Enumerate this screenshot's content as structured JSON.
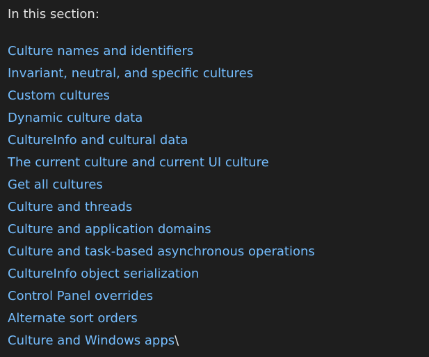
{
  "section": {
    "heading": "In this section:",
    "links": [
      "Culture names and identifiers",
      "Invariant, neutral, and specific cultures",
      "Custom cultures",
      "Dynamic culture data",
      "CultureInfo and cultural data",
      "The current culture and current UI culture",
      "Get all cultures",
      "Culture and threads",
      "Culture and application domains",
      "Culture and task-based asynchronous operations",
      "CultureInfo object serialization",
      "Control Panel overrides",
      "Alternate sort orders",
      "Culture and Windows apps"
    ],
    "trailing_text": "\\"
  },
  "colors": {
    "background": "#1e1e1e",
    "text": "#e6e6e6",
    "link": "#75beff"
  }
}
